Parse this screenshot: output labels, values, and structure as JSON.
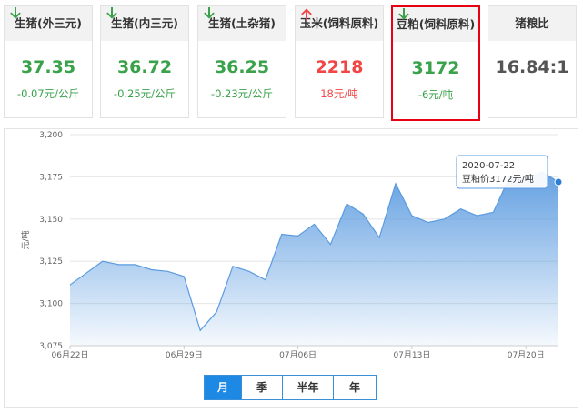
{
  "cards": [
    {
      "title": "生猪(外三元)",
      "price": "37.35",
      "change": "-0.07元/公斤",
      "trend": "down"
    },
    {
      "title": "生猪(内三元)",
      "price": "36.72",
      "change": "-0.25元/公斤",
      "trend": "down"
    },
    {
      "title": "生猪(土杂猪)",
      "price": "36.25",
      "change": "-0.23元/公斤",
      "trend": "down"
    },
    {
      "title": "玉米(饲料原料)",
      "price": "2218",
      "change": "18元/吨",
      "trend": "up"
    },
    {
      "title": "豆粕(饲料原料)",
      "price": "3172",
      "change": "-6元/吨",
      "trend": "down"
    },
    {
      "title": "猪粮比",
      "price": "16.84:1",
      "change": "",
      "trend": "none"
    }
  ],
  "colors": {
    "down": "#3aa24a",
    "up": "#f04646",
    "selected_border": "#e60012",
    "accent": "#1e88e5",
    "series": "#5b9be0"
  },
  "chart_data": {
    "type": "area",
    "ylabel": "元/吨",
    "ylim": [
      3075,
      3200
    ],
    "yticks": [
      3075,
      3100,
      3125,
      3150,
      3175,
      3200
    ],
    "ytick_labels": [
      "3,075",
      "3,100",
      "3,125",
      "3,150",
      "3,175",
      "3,200"
    ],
    "xtick_labels": [
      "06月22日",
      "06月29日",
      "07月06日",
      "07月13日",
      "07月20日"
    ],
    "xtick_index": [
      0,
      7,
      14,
      21,
      28
    ],
    "x": [
      "06-22",
      "06-23",
      "06-24",
      "06-25",
      "06-26",
      "06-27",
      "06-28",
      "06-29",
      "06-30",
      "07-01",
      "07-02",
      "07-03",
      "07-04",
      "07-05",
      "07-06",
      "07-07",
      "07-08",
      "07-09",
      "07-10",
      "07-11",
      "07-12",
      "07-13",
      "07-14",
      "07-15",
      "07-16",
      "07-17",
      "07-18",
      "07-19",
      "07-20",
      "07-21",
      "07-22"
    ],
    "values": [
      3111,
      3118,
      3125,
      3123,
      3123,
      3120,
      3119,
      3116,
      3084,
      3095,
      3122,
      3119,
      3114,
      3141,
      3140,
      3147,
      3135,
      3159,
      3153,
      3139,
      3171,
      3152,
      3148,
      3150,
      3156,
      3152,
      3154,
      3175,
      3174,
      3178,
      3172
    ],
    "tooltip": {
      "date": "2020-07-22",
      "text": "豆粕价3172元/吨"
    }
  },
  "tabs": [
    {
      "label": "月",
      "active": true
    },
    {
      "label": "季",
      "active": false
    },
    {
      "label": "半年",
      "active": false
    },
    {
      "label": "年",
      "active": false
    }
  ]
}
